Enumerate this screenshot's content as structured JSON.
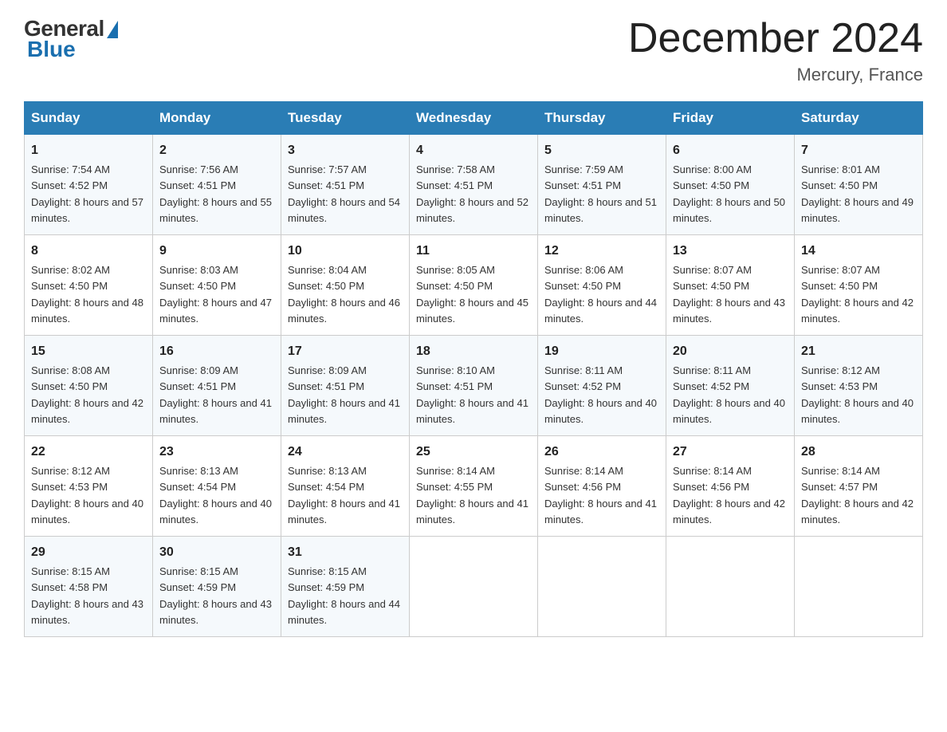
{
  "logo": {
    "general": "General",
    "blue": "Blue"
  },
  "header": {
    "title": "December 2024",
    "location": "Mercury, France"
  },
  "columns": [
    "Sunday",
    "Monday",
    "Tuesday",
    "Wednesday",
    "Thursday",
    "Friday",
    "Saturday"
  ],
  "weeks": [
    [
      {
        "day": "1",
        "sunrise": "7:54 AM",
        "sunset": "4:52 PM",
        "daylight": "8 hours and 57 minutes."
      },
      {
        "day": "2",
        "sunrise": "7:56 AM",
        "sunset": "4:51 PM",
        "daylight": "8 hours and 55 minutes."
      },
      {
        "day": "3",
        "sunrise": "7:57 AM",
        "sunset": "4:51 PM",
        "daylight": "8 hours and 54 minutes."
      },
      {
        "day": "4",
        "sunrise": "7:58 AM",
        "sunset": "4:51 PM",
        "daylight": "8 hours and 52 minutes."
      },
      {
        "day": "5",
        "sunrise": "7:59 AM",
        "sunset": "4:51 PM",
        "daylight": "8 hours and 51 minutes."
      },
      {
        "day": "6",
        "sunrise": "8:00 AM",
        "sunset": "4:50 PM",
        "daylight": "8 hours and 50 minutes."
      },
      {
        "day": "7",
        "sunrise": "8:01 AM",
        "sunset": "4:50 PM",
        "daylight": "8 hours and 49 minutes."
      }
    ],
    [
      {
        "day": "8",
        "sunrise": "8:02 AM",
        "sunset": "4:50 PM",
        "daylight": "8 hours and 48 minutes."
      },
      {
        "day": "9",
        "sunrise": "8:03 AM",
        "sunset": "4:50 PM",
        "daylight": "8 hours and 47 minutes."
      },
      {
        "day": "10",
        "sunrise": "8:04 AM",
        "sunset": "4:50 PM",
        "daylight": "8 hours and 46 minutes."
      },
      {
        "day": "11",
        "sunrise": "8:05 AM",
        "sunset": "4:50 PM",
        "daylight": "8 hours and 45 minutes."
      },
      {
        "day": "12",
        "sunrise": "8:06 AM",
        "sunset": "4:50 PM",
        "daylight": "8 hours and 44 minutes."
      },
      {
        "day": "13",
        "sunrise": "8:07 AM",
        "sunset": "4:50 PM",
        "daylight": "8 hours and 43 minutes."
      },
      {
        "day": "14",
        "sunrise": "8:07 AM",
        "sunset": "4:50 PM",
        "daylight": "8 hours and 42 minutes."
      }
    ],
    [
      {
        "day": "15",
        "sunrise": "8:08 AM",
        "sunset": "4:50 PM",
        "daylight": "8 hours and 42 minutes."
      },
      {
        "day": "16",
        "sunrise": "8:09 AM",
        "sunset": "4:51 PM",
        "daylight": "8 hours and 41 minutes."
      },
      {
        "day": "17",
        "sunrise": "8:09 AM",
        "sunset": "4:51 PM",
        "daylight": "8 hours and 41 minutes."
      },
      {
        "day": "18",
        "sunrise": "8:10 AM",
        "sunset": "4:51 PM",
        "daylight": "8 hours and 41 minutes."
      },
      {
        "day": "19",
        "sunrise": "8:11 AM",
        "sunset": "4:52 PM",
        "daylight": "8 hours and 40 minutes."
      },
      {
        "day": "20",
        "sunrise": "8:11 AM",
        "sunset": "4:52 PM",
        "daylight": "8 hours and 40 minutes."
      },
      {
        "day": "21",
        "sunrise": "8:12 AM",
        "sunset": "4:53 PM",
        "daylight": "8 hours and 40 minutes."
      }
    ],
    [
      {
        "day": "22",
        "sunrise": "8:12 AM",
        "sunset": "4:53 PM",
        "daylight": "8 hours and 40 minutes."
      },
      {
        "day": "23",
        "sunrise": "8:13 AM",
        "sunset": "4:54 PM",
        "daylight": "8 hours and 40 minutes."
      },
      {
        "day": "24",
        "sunrise": "8:13 AM",
        "sunset": "4:54 PM",
        "daylight": "8 hours and 41 minutes."
      },
      {
        "day": "25",
        "sunrise": "8:14 AM",
        "sunset": "4:55 PM",
        "daylight": "8 hours and 41 minutes."
      },
      {
        "day": "26",
        "sunrise": "8:14 AM",
        "sunset": "4:56 PM",
        "daylight": "8 hours and 41 minutes."
      },
      {
        "day": "27",
        "sunrise": "8:14 AM",
        "sunset": "4:56 PM",
        "daylight": "8 hours and 42 minutes."
      },
      {
        "day": "28",
        "sunrise": "8:14 AM",
        "sunset": "4:57 PM",
        "daylight": "8 hours and 42 minutes."
      }
    ],
    [
      {
        "day": "29",
        "sunrise": "8:15 AM",
        "sunset": "4:58 PM",
        "daylight": "8 hours and 43 minutes."
      },
      {
        "day": "30",
        "sunrise": "8:15 AM",
        "sunset": "4:59 PM",
        "daylight": "8 hours and 43 minutes."
      },
      {
        "day": "31",
        "sunrise": "8:15 AM",
        "sunset": "4:59 PM",
        "daylight": "8 hours and 44 minutes."
      },
      null,
      null,
      null,
      null
    ]
  ]
}
